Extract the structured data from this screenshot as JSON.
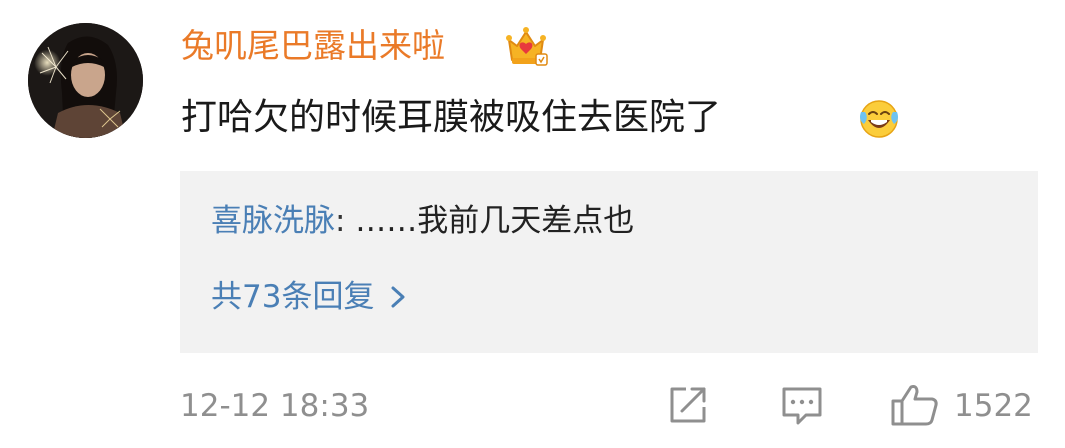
{
  "comment": {
    "username": "兔叽尾巴露出来啦",
    "text": "打哈欠的时候耳膜被吸住去医院了",
    "reply": {
      "user": "喜脉洗脉",
      "colon": ":",
      "content": " ……我前几天差点也"
    },
    "more_replies_label": "共73条回复",
    "timestamp": "12-12 18:33",
    "like_count": "1522"
  },
  "icons": {
    "avatar": "avatar",
    "badge": "crown-vip-badge-icon",
    "emoji": "laughing-crying-emoji-icon",
    "chevron": "chevron-right-icon",
    "share": "share-icon",
    "comment": "comment-icon",
    "like": "thumbs-up-icon"
  },
  "colors": {
    "username": "#ea7a28",
    "link": "#4a7fb5",
    "muted": "#8f8f8f",
    "reply_bg": "#f2f2f2"
  }
}
